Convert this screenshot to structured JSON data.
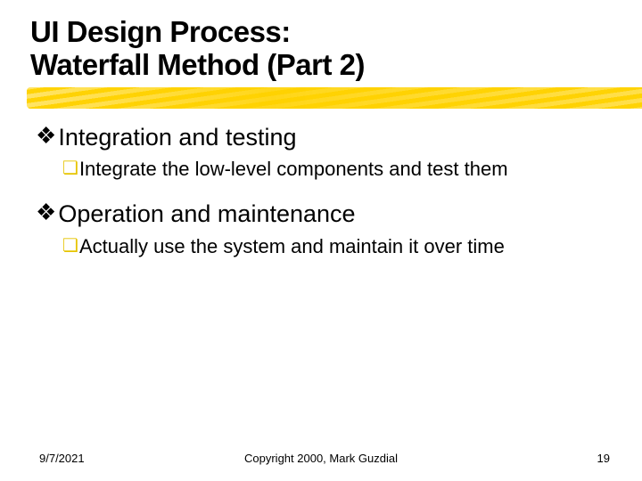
{
  "title_line1": "UI Design Process:",
  "title_line2": "Waterfall Method (Part 2)",
  "items": [
    {
      "label": "Integration and testing",
      "sub": "Integrate the low-level components and test them"
    },
    {
      "label": "Operation and maintenance",
      "sub": "Actually use the system and maintain it over time"
    }
  ],
  "footer": {
    "date": "9/7/2021",
    "copyright": "Copyright 2000, Mark Guzdial",
    "page": "19"
  },
  "bullets": {
    "level1": "❖",
    "level2": "❏"
  }
}
